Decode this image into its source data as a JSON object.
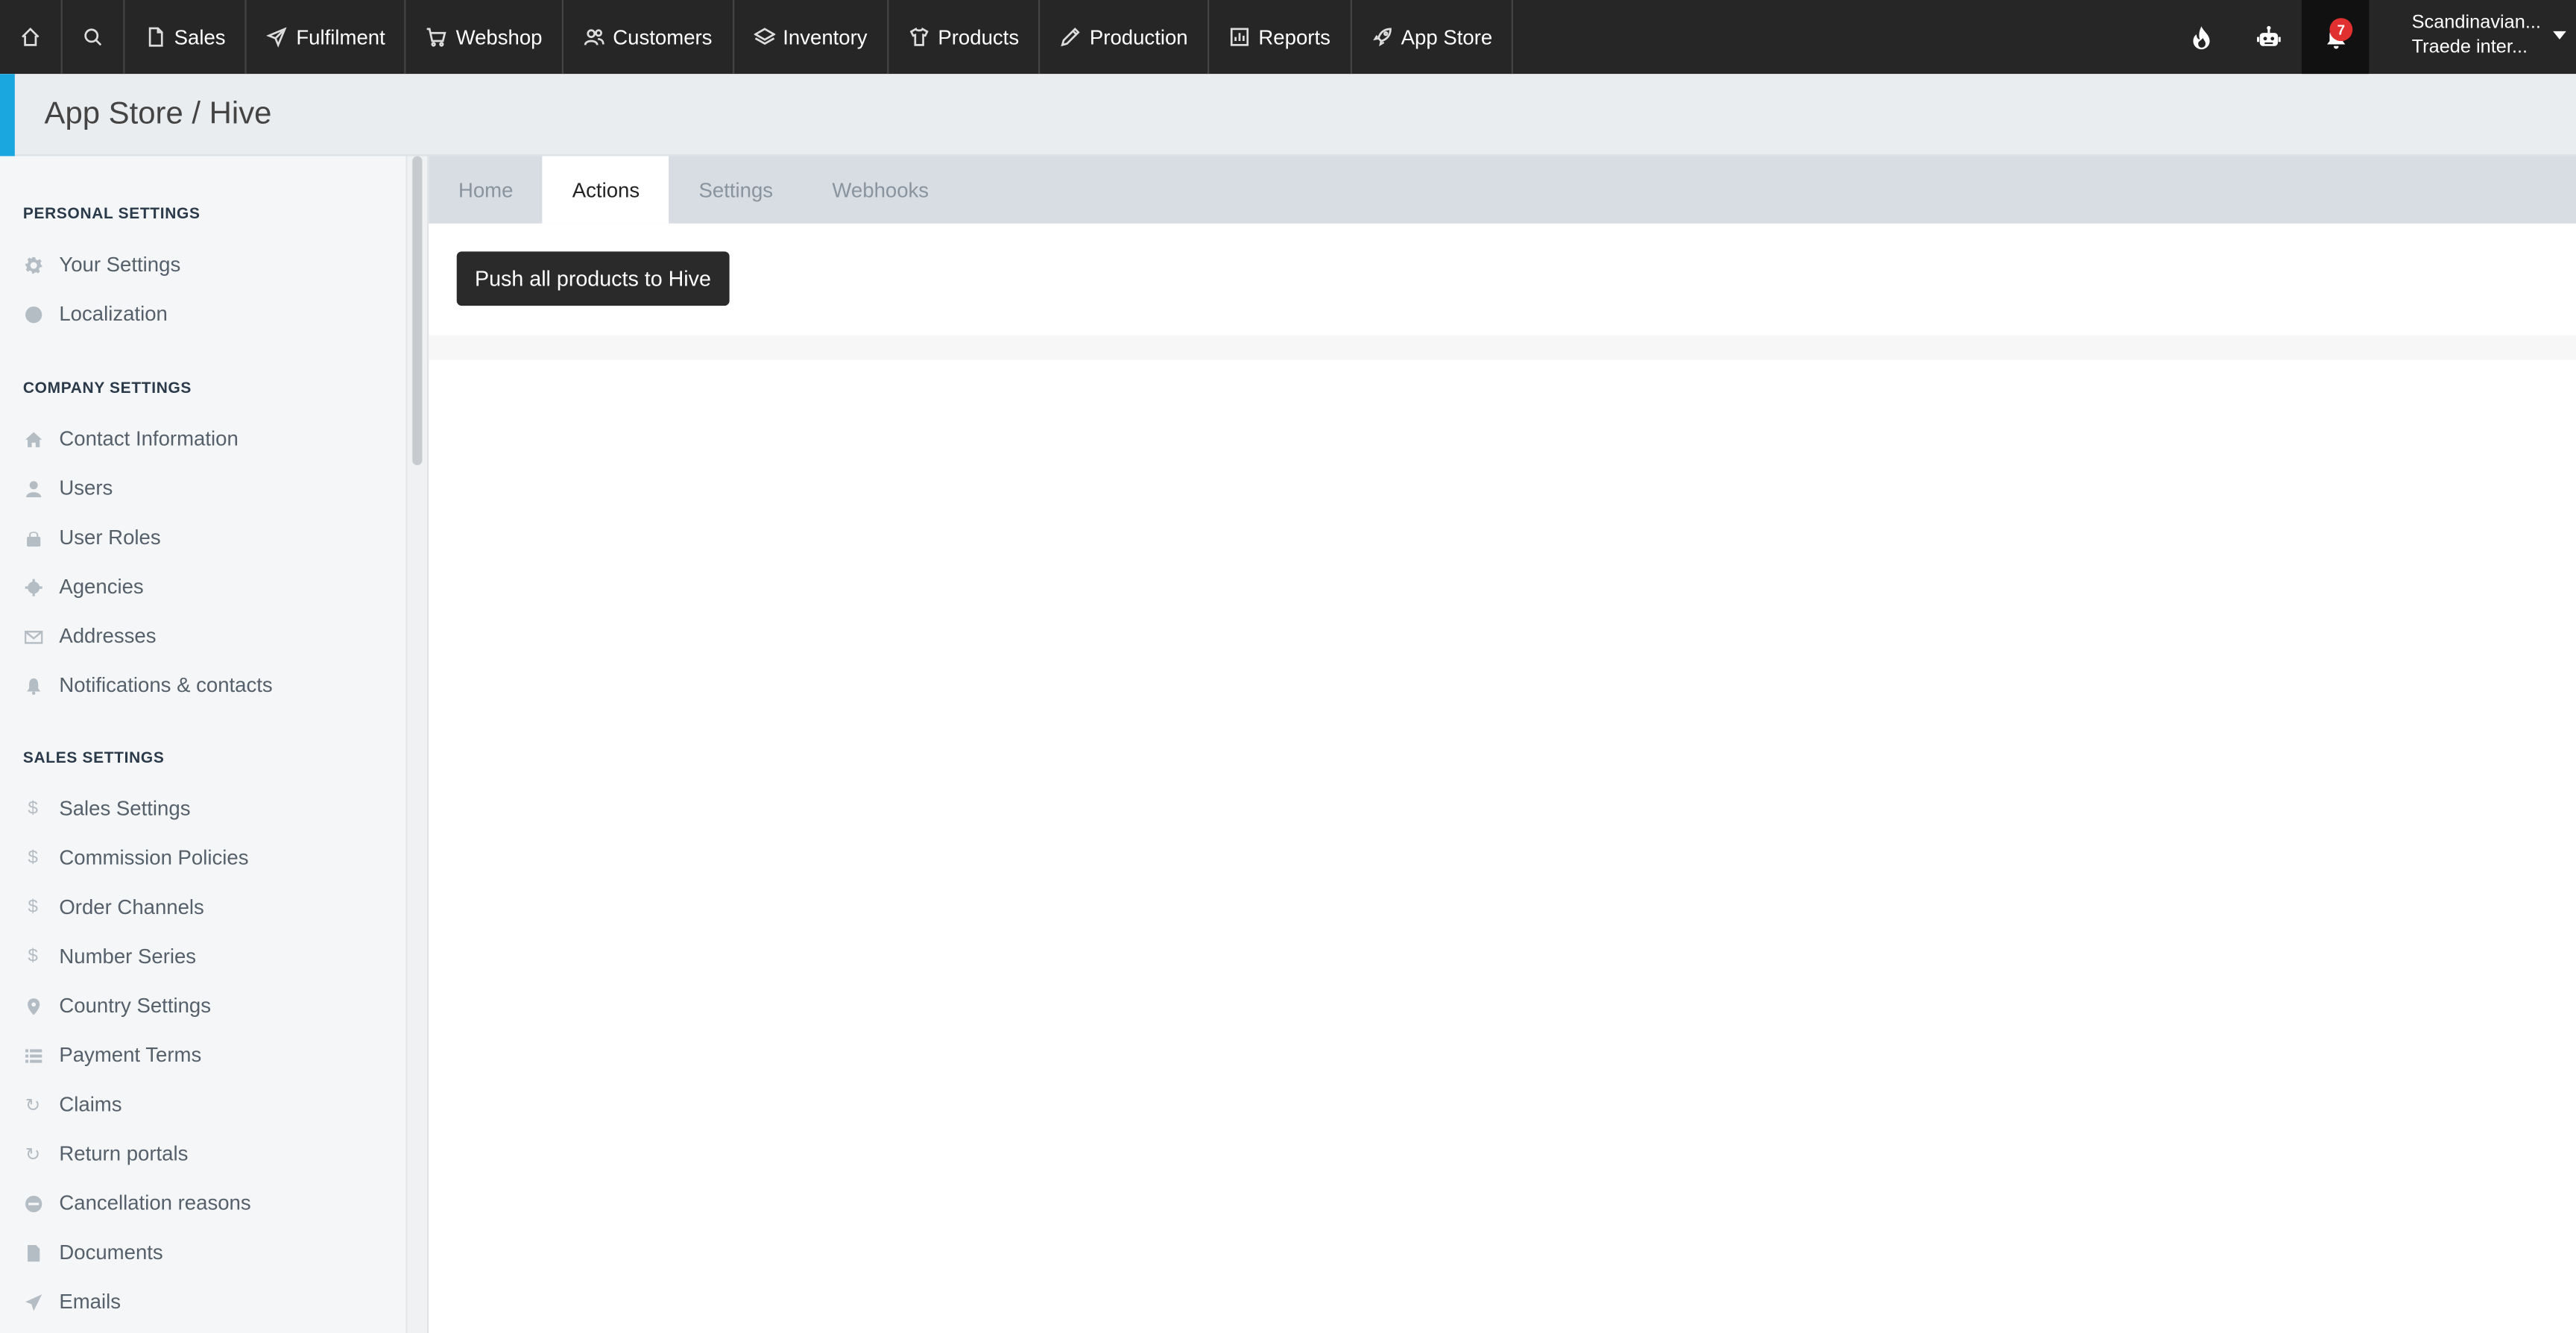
{
  "nav": {
    "items": [
      {
        "label": "Sales",
        "icon": "document-icon"
      },
      {
        "label": "Fulfilment",
        "icon": "paper-plane-icon"
      },
      {
        "label": "Webshop",
        "icon": "cart-icon"
      },
      {
        "label": "Customers",
        "icon": "users-icon"
      },
      {
        "label": "Inventory",
        "icon": "layers-icon"
      },
      {
        "label": "Products",
        "icon": "shirt-icon"
      },
      {
        "label": "Production",
        "icon": "pencil-icon"
      },
      {
        "label": "Reports",
        "icon": "report-icon"
      },
      {
        "label": "App Store",
        "icon": "rocket-icon"
      }
    ],
    "notification_count": "7",
    "company_line1": "Scandinavian...",
    "company_line2": "Traede inter..."
  },
  "page": {
    "title": "App Store / Hive"
  },
  "sidebar": {
    "personal_header": "PERSONAL SETTINGS",
    "personal": [
      {
        "label": "Your Settings",
        "icon": "gear-icon"
      },
      {
        "label": "Localization",
        "icon": "globe-icon"
      }
    ],
    "company_header": "COMPANY SETTINGS",
    "company": [
      {
        "label": "Contact Information",
        "icon": "home-icon"
      },
      {
        "label": "Users",
        "icon": "user-icon"
      },
      {
        "label": "User Roles",
        "icon": "lock-icon"
      },
      {
        "label": "Agencies",
        "icon": "cog-icon"
      },
      {
        "label": "Addresses",
        "icon": "envelope-icon"
      },
      {
        "label": "Notifications & contacts",
        "icon": "bell-icon"
      }
    ],
    "sales_header": "SALES SETTINGS",
    "sales": [
      {
        "label": "Sales Settings",
        "icon": "dollar-icon"
      },
      {
        "label": "Commission Policies",
        "icon": "dollar-icon"
      },
      {
        "label": "Order Channels",
        "icon": "dollar-icon"
      },
      {
        "label": "Number Series",
        "icon": "dollar-icon"
      },
      {
        "label": "Country Settings",
        "icon": "map-pin-icon"
      },
      {
        "label": "Payment Terms",
        "icon": "list-icon"
      },
      {
        "label": "Claims",
        "icon": "refresh-icon"
      },
      {
        "label": "Return portals",
        "icon": "refresh-icon"
      },
      {
        "label": "Cancellation reasons",
        "icon": "ban-icon"
      },
      {
        "label": "Documents",
        "icon": "file-icon"
      },
      {
        "label": "Emails",
        "icon": "send-icon"
      }
    ]
  },
  "tabs": [
    {
      "label": "Home",
      "active": false
    },
    {
      "label": "Actions",
      "active": true
    },
    {
      "label": "Settings",
      "active": false
    },
    {
      "label": "Webhooks",
      "active": false
    }
  ],
  "actions": {
    "push_button": "Push all products to Hive"
  }
}
